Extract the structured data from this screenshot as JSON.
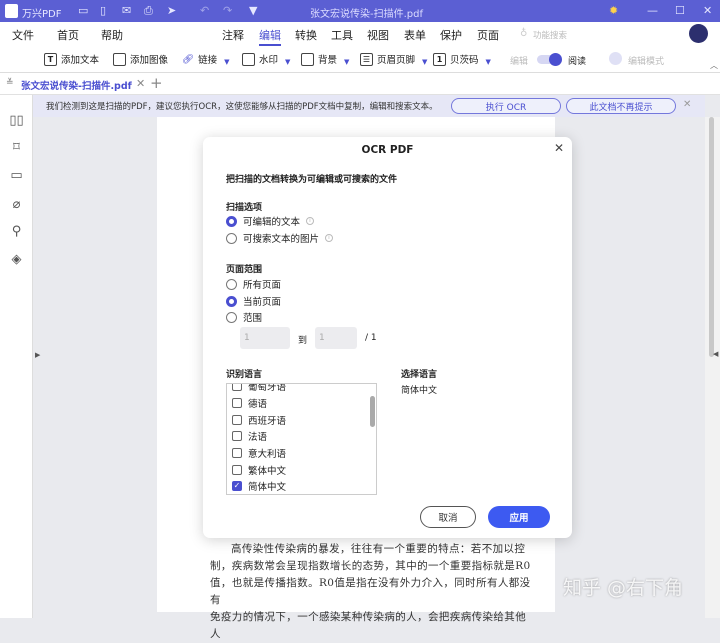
{
  "app": {
    "name": "万兴PDF",
    "window_title": "张文宏说传染-扫描件.pdf"
  },
  "menu": {
    "left": [
      "文件",
      "首页",
      "帮助"
    ],
    "center": [
      "注释",
      "编辑",
      "转换",
      "工具",
      "视图",
      "表单",
      "保护",
      "页面"
    ],
    "active": "编辑",
    "search": "功能搜索"
  },
  "toolbar": {
    "add_text": "添加文本",
    "add_image": "添加图像",
    "link": "链接",
    "watermark": "水印",
    "background": "背景",
    "header_footer": "页眉页脚",
    "bates": "贝茨码",
    "edit": "编辑",
    "read": "阅读",
    "edit_mode": "编辑模式"
  },
  "tab": {
    "label": "张文宏说传染-扫描件.pdf"
  },
  "banner": {
    "message": "我们检测到这是扫描的PDF，建议您执行OCR，这使您能够从扫描的PDF文档中复制，编辑和搜索文本。",
    "run_ocr": "执行 OCR",
    "dont_remind": "此文档不再提示"
  },
  "dialog": {
    "title": "OCR PDF",
    "subtitle": "把扫描的文档转换为可编辑或可搜索的文件",
    "scan_label": "扫描选项",
    "scan_options": [
      {
        "label": "可编辑的文本",
        "checked": true
      },
      {
        "label": "可搜索文本的图片",
        "checked": false
      }
    ],
    "range_label": "页面范围",
    "range_options": [
      {
        "label": "所有页面",
        "checked": false
      },
      {
        "label": "当前页面",
        "checked": true
      },
      {
        "label": "范围",
        "checked": false
      }
    ],
    "range_from": "1",
    "range_to_label": "到",
    "range_to": "1",
    "range_total": "/ 1",
    "lang_label": "识别语言",
    "languages": [
      {
        "label": "葡萄牙语",
        "checked": false
      },
      {
        "label": "德语",
        "checked": false
      },
      {
        "label": "西班牙语",
        "checked": false
      },
      {
        "label": "法语",
        "checked": false
      },
      {
        "label": "意大利语",
        "checked": false
      },
      {
        "label": "繁体中文",
        "checked": false
      },
      {
        "label": "简体中文",
        "checked": true
      }
    ],
    "selected_label": "选择语言",
    "selected_value": "简体中文",
    "cancel": "取消",
    "apply": "应用"
  },
  "page_text": [
    "高传染性传染病的暴发，往往有一个重要的特点：若不加以控",
    "制，疾病数常会呈现指数增长的态势，其中的一个重要指标就是R0",
    "值，也就是传播指数。R0值是指在没有外力介入，同时所有人都没有",
    "免疫力的情况下，一个感染某种传染病的人，会把疾病传染给其他人"
  ],
  "watermark": "知乎 @右下角",
  "colors": {
    "accent": "#4a4fd0",
    "titlebar": "#5b5fd3",
    "apply": "#3d5af1"
  }
}
